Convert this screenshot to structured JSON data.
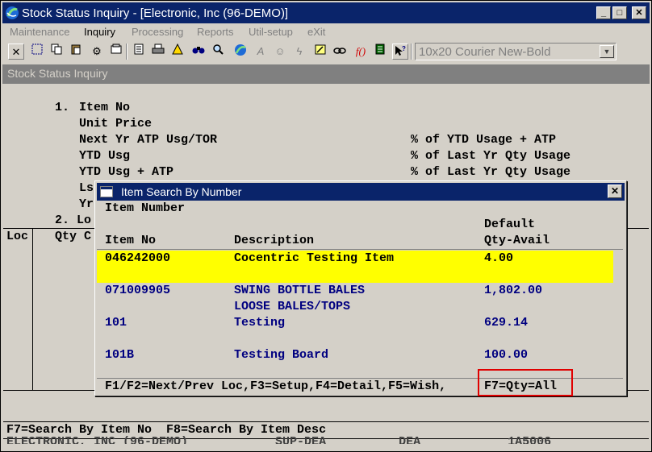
{
  "window": {
    "title": "Stock Status Inquiry - [Electronic, Inc (96-DEMO)]",
    "controls": {
      "minimize": "_",
      "maximize": "□",
      "close": "✕"
    }
  },
  "menu": [
    "Maintenance",
    "Inquiry",
    "Processing",
    "Reports",
    "Util-setup",
    "eXit"
  ],
  "toolbar": {
    "font_selector": "10x20 Courier New-Bold",
    "icons": [
      "cut-icon",
      "select-icon",
      "copy-icon",
      "paste-icon",
      "settings-icon",
      "screen-icon",
      "list-icon",
      "print-icon",
      "alert-icon",
      "binoculars-icon",
      "search-icon",
      "globe-icon",
      "font-icon",
      "user-icon",
      "lightning-icon",
      "edit-icon",
      "link-icon",
      "function-icon",
      "calculator-icon",
      "help-pointer-icon"
    ]
  },
  "screen": {
    "header": "Stock Status Inquiry",
    "lines": {
      "l1_num": "1.",
      "l1_label": "Item No",
      "l1b": "Unit Price",
      "l1c": "Next Yr ATP Usg/TOR",
      "l1c_r": "% of YTD Usage + ATP",
      "l1d": "YTD Usg",
      "l1d_r": "% of Last Yr Qty Usage",
      "l1e": "YTD Usg + ATP",
      "l1e_r": "% of Last Yr Qty Usage",
      "l1f": "Ls",
      "l1g": "Yr",
      "l2": "2. Lo",
      "col_loc": "Loc",
      "col_qty": "Qty C"
    },
    "footer1": "F7=Search By Item No  F8=Search By Item Desc",
    "footer2": "ELECTRONIC, INC (96-DEMO)            SUP-DEA          DEA            1A5006"
  },
  "dialog": {
    "title": "Item Search By Number",
    "close": "✕",
    "subtitle": "Item Number",
    "headers": {
      "item_no": "Item No",
      "description": "Description",
      "qty_top": "Default",
      "qty": "Qty-Avail"
    },
    "rows": [
      {
        "item_no": "046242000",
        "description": "Cocentric Testing Item",
        "desc2": "",
        "qty": "4.00"
      },
      {
        "item_no": "071009905",
        "description": "SWING BOTTLE BALES",
        "desc2": "LOOSE BALES/TOPS",
        "qty": "1,802.00"
      },
      {
        "item_no": "101",
        "description": "Testing",
        "desc2": "",
        "qty": "629.14"
      },
      {
        "item_no": "101B",
        "description": "Testing Board",
        "desc2": "",
        "qty": "100.00"
      }
    ],
    "footer_left": "F1/F2=Next/Prev Loc,F3=Setup,F4=Detail,F5=Wish,",
    "footer_right": "F7=Qty=All"
  }
}
